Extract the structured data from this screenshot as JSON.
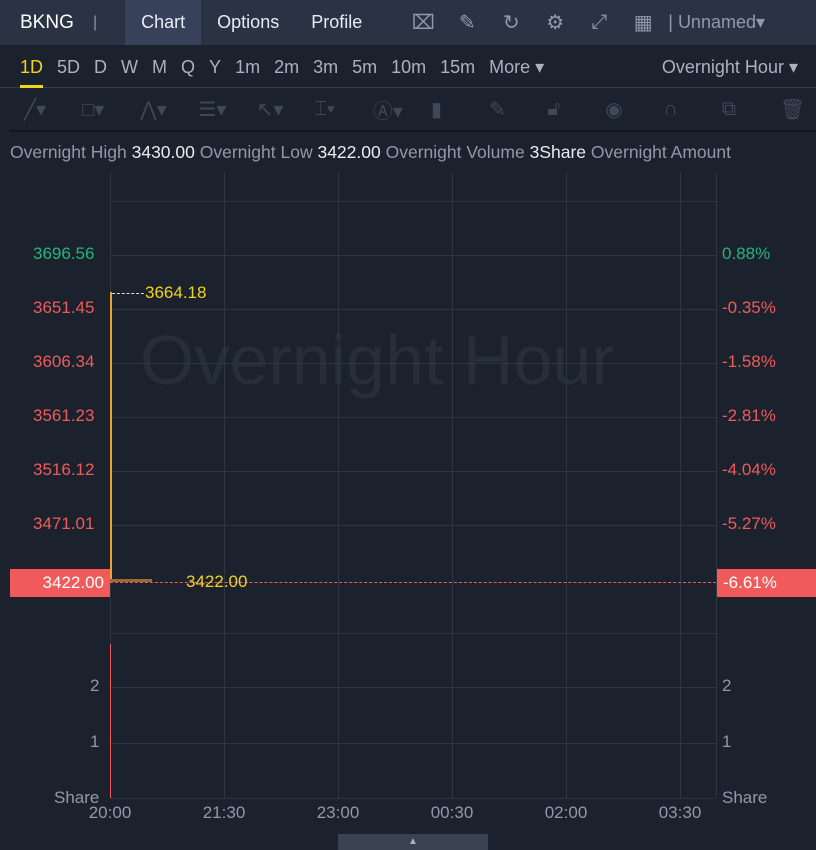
{
  "header": {
    "symbol": "BKNG",
    "tabs": [
      "Chart",
      "Options",
      "Profile"
    ],
    "icons": [
      "chart-icon",
      "edit-icon",
      "refresh-icon",
      "gear-icon",
      "fullscreen-icon",
      "layout-icon"
    ],
    "layout_name": "Unnamed"
  },
  "periods": [
    "1D",
    "5D",
    "D",
    "W",
    "M",
    "Q",
    "Y",
    "1m",
    "2m",
    "3m",
    "5m",
    "10m",
    "15m",
    "More"
  ],
  "session": "Overnight Hour",
  "info": {
    "high_label": "Overnight High",
    "high": "3430.00",
    "low_label": "Overnight Low",
    "low": "3422.00",
    "vol_label": "Overnight Volume",
    "vol": "3Share",
    "amt_label": "Overnight Amount"
  },
  "chart_data": {
    "type": "line",
    "watermark": "Overnight Hour",
    "price_labels": [
      "3696.56",
      "3651.45",
      "3606.34",
      "3561.23",
      "3516.12",
      "3471.01"
    ],
    "pct_labels": [
      "0.88%",
      "-0.35%",
      "-1.58%",
      "-2.81%",
      "-4.04%",
      "-5.27%"
    ],
    "last_price": "3422.00",
    "last_pct": "-6.61%",
    "high_mark": "3664.18",
    "low_mark": "3422.00",
    "volume_ticks": [
      "2",
      "1"
    ],
    "volume_unit": "Share",
    "x_ticks": [
      "20:00",
      "21:30",
      "23:00",
      "00:30",
      "02:00",
      "03:30"
    ],
    "colors": {
      "up": "#26b47a",
      "down": "#f05a5a",
      "mark": "#f2d31b"
    }
  }
}
